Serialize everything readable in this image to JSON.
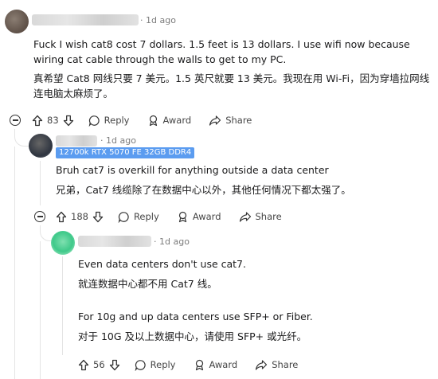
{
  "comments": [
    {
      "time": "· 1d ago",
      "text_en": "Fuck I wish cat8 cost 7 dollars. 1.5 feet is 13 dollars. I use wifi now because wiring cat cable through the walls to get to my PC.",
      "text_cn": "真希望 Cat8 网线只要 7 美元。1.5 英尺就要 13 美元。我现在用 Wi-Fi，因为穿墙拉网线连电脑太麻烦了。",
      "votes": "83",
      "reply_label": "Reply",
      "award_label": "Award",
      "share_label": "Share"
    },
    {
      "time": "· 1d ago",
      "flair": "12700k RTX 5070 FE 32GB DDR4",
      "text_en": "Bruh cat7 is overkill for anything outside a data center",
      "text_cn": "兄弟，Cat7 线缆除了在数据中心以外，其他任何情况下都太强了。",
      "votes": "188",
      "reply_label": "Reply",
      "award_label": "Award",
      "share_label": "Share"
    },
    {
      "time": "· 1d ago",
      "text_en_1": "Even data centers don't use cat7.",
      "text_cn_1": "就连数据中心都不用 Cat7 线。",
      "text_en_2": "For 10g and up data centers use SFP+ or Fiber.",
      "text_cn_2": "对于 10G 及以上数据中心，请使用 SFP+ 或光纤。",
      "votes": "56",
      "reply_label": "Reply",
      "award_label": "Award",
      "share_label": "Share"
    }
  ],
  "colors": {
    "flair_bg": "#5b9cf0",
    "thread_line": "#e4e4e4",
    "meta_text": "#7c7c7c"
  }
}
